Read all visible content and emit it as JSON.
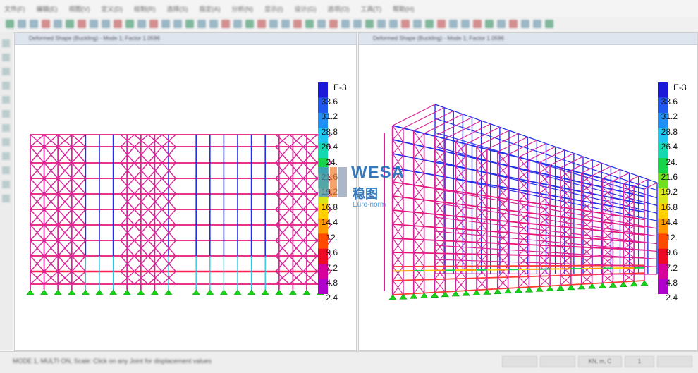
{
  "menubar": {
    "items": [
      "文件(F)",
      "编辑(E)",
      "视图(V)",
      "定义(D)",
      "绘制(R)",
      "选择(S)",
      "指定(A)",
      "分析(N)",
      "显示(I)",
      "设计(G)",
      "选项(O)",
      "工具(T)",
      "帮助(H)"
    ]
  },
  "panes": {
    "left": {
      "title": "Deformed Shape (Buckling) - Mode 1; Factor 1.0596"
    },
    "right": {
      "title": "Deformed Shape (Buckling) - Mode 1; Factor 1.0596"
    }
  },
  "legend": {
    "title": "E-3",
    "labels": [
      "33.6",
      "31.2",
      "28.8",
      "26.4",
      "24.",
      "21.6",
      "19.2",
      "16.8",
      "14.4",
      "12.",
      "9.6",
      "7.2",
      "4.8",
      "2.4"
    ],
    "colors": [
      "#1a1ad8",
      "#1e58ee",
      "#1f8ff5",
      "#20c6f0",
      "#13d8b0",
      "#18d44a",
      "#6fe020",
      "#d8e81a",
      "#ffd000",
      "#ff9a00",
      "#ff4a00",
      "#ee0a22",
      "#d6009a",
      "#b000cc"
    ]
  },
  "watermark": {
    "latin": "WESA",
    "cjk": "稳图",
    "sub": "Euro-norm"
  },
  "status": {
    "text": "MODE 1, MULTI ON, Scale: Click on any Joint for displacement values",
    "fields": [
      "",
      "",
      "KN, m, C",
      "1",
      ""
    ]
  },
  "frame_colors": {
    "frame": "#d8249a",
    "beam": "#e6157a",
    "blue": "#2430e8",
    "support": "#19d419"
  }
}
